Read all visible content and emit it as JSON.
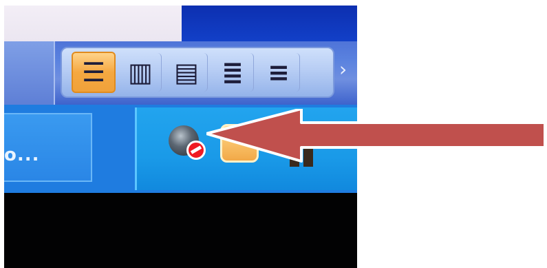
{
  "toolbar": {
    "buttons": [
      {
        "icon": "normal-view-icon",
        "active": true
      },
      {
        "icon": "reading-layout-icon",
        "active": false
      },
      {
        "icon": "web-layout-icon",
        "active": false
      },
      {
        "icon": "outline-view-icon",
        "active": false
      },
      {
        "icon": "print-layout-icon",
        "active": false
      }
    ]
  },
  "taskbar": {
    "task_label": "o...",
    "tray_icons": [
      "network-disconnected-icon",
      "security-center-icon",
      "tray-misc-icon"
    ]
  },
  "annotation": {
    "arrow_color": "#c0504d",
    "points_to": "network-disconnected-icon"
  }
}
